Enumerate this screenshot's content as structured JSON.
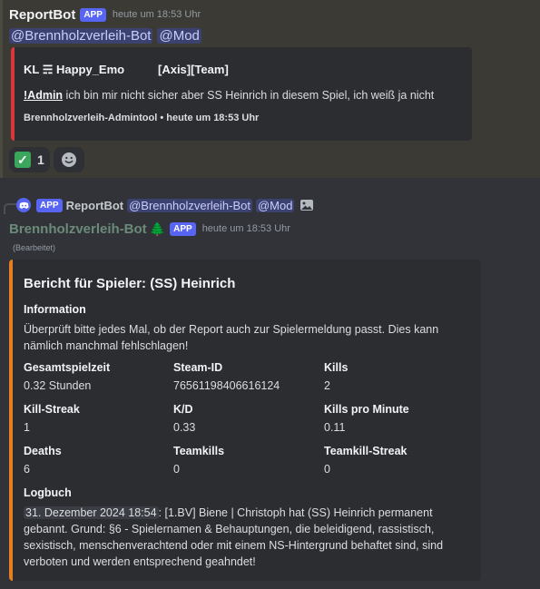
{
  "message1": {
    "author": "ReportBot",
    "badge": "APP",
    "timestamp": "heute um 18:53 Uhr",
    "mentions": [
      "@Brennholzverleih-Bot",
      "@Mod"
    ],
    "embed": {
      "author": "KL ☴ Happy_Emo",
      "team": "[Axis][Team]",
      "desc_strong": "!Admin",
      "desc_rest": " ich bin mir nicht sicher aber SS Heinrich in diesem Spiel, ich weiß ja nicht",
      "footer": "Brennholzverleih-Admintool • heute um 18:53 Uhr",
      "accent": "#da373c"
    },
    "reactions": [
      {
        "emoji": "✓",
        "count": "1"
      }
    ]
  },
  "message2": {
    "reply": {
      "badge": "APP",
      "author": "ReportBot",
      "mentions": [
        "@Brennholzverleih-Bot",
        "@Mod"
      ]
    },
    "author": "Brennholzverleih-Bot",
    "author_icon": "🌲",
    "badge": "APP",
    "timestamp": "heute um 18:53 Uhr",
    "edited": "(Bearbeitet)",
    "embed": {
      "accent": "#e67e22",
      "title": "Bericht für Spieler: (SS) Heinrich",
      "info_title": "Information",
      "info_text": "Überprüft bitte jedes Mal, ob der Report auch zur Spielermeldung passt. Dies kann nämlich manchmal fehlschlagen!",
      "fields": [
        {
          "name": "Gesamtspielzeit",
          "value": "0.32 Stunden"
        },
        {
          "name": "Steam-ID",
          "value": "76561198406616124"
        },
        {
          "name": "Kills",
          "value": "2"
        },
        {
          "name": "Kill-Streak",
          "value": "1"
        },
        {
          "name": "K/D",
          "value": "0.33"
        },
        {
          "name": "Kills pro Minute",
          "value": "0.11"
        },
        {
          "name": "Deaths",
          "value": "6"
        },
        {
          "name": "Teamkills",
          "value": "0"
        },
        {
          "name": "Teamkill-Streak",
          "value": "0"
        }
      ],
      "log_title": "Logbuch",
      "log_date": "31. Dezember 2024 18:54",
      "log_text": ": [1.BV] Biene | Christoph hat (SS) Heinrich permanent gebannt. Grund: §6 - Spielernamen & Behauptungen, die beleidigend, rassistisch, sexistisch, menschenverachtend oder mit einem NS-Hintergrund behaftet sind, sind verboten und werden entsprechend geahndet!"
    }
  }
}
